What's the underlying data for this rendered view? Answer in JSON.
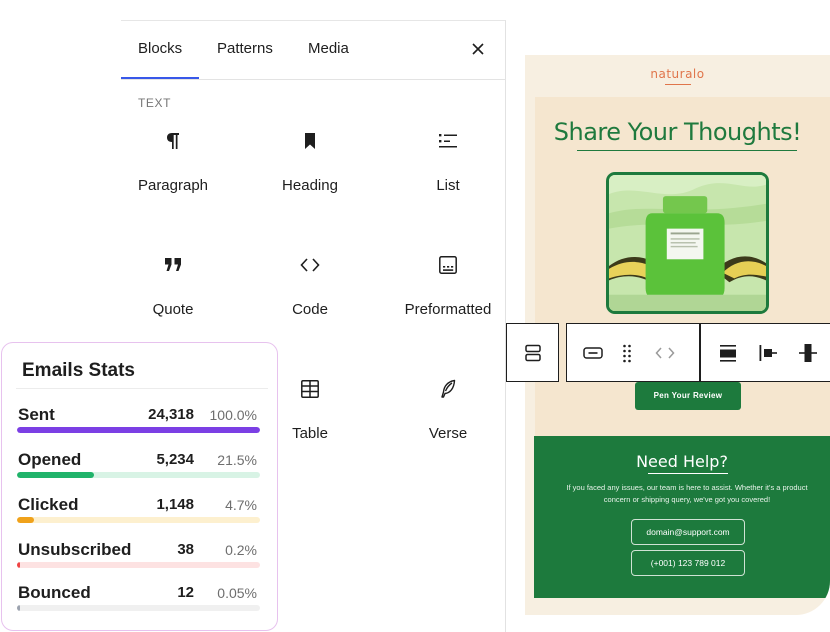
{
  "inserter": {
    "tabs": [
      {
        "label": "Blocks",
        "active": true
      },
      {
        "label": "Patterns",
        "active": false
      },
      {
        "label": "Media",
        "active": false
      }
    ],
    "close_icon": "close-icon",
    "section_label": "TEXT",
    "blocks": [
      {
        "label": "Paragraph",
        "icon": "paragraph-icon"
      },
      {
        "label": "Heading",
        "icon": "heading-bookmark-icon"
      },
      {
        "label": "List",
        "icon": "list-icon"
      },
      {
        "label": "Quote",
        "icon": "quote-icon"
      },
      {
        "label": "Code",
        "icon": "code-icon"
      },
      {
        "label": "Preformatted",
        "icon": "preformatted-icon"
      },
      {
        "label": "Table",
        "icon": "table-icon"
      },
      {
        "label": "Verse",
        "icon": "verse-feather-icon"
      }
    ]
  },
  "email": {
    "brand": "naturalo",
    "hero_title": "Share Your Thoughts!",
    "product_label": "GLOW RECIPE",
    "review_button": "Pen Your Review",
    "help_title": "Need Help?",
    "help_text": "If you faced any issues, our team is here to assist. Whether it's a product concern or shipping query, we've got you covered!",
    "contact_email": "domain@support.com",
    "contact_phone": "(+001) 123 789 012",
    "colors": {
      "brand_green": "#1d7a3d",
      "brand_orange": "#e0754b",
      "background": "#f7efe1"
    }
  },
  "toolbar": {
    "icons": [
      "group-block-icon",
      "button-block-icon",
      "drag-handle-icon",
      "move-arrows-icon",
      "align-top-icon",
      "align-left-icon",
      "align-center-icon"
    ]
  },
  "stats": {
    "title": "Emails Stats",
    "rows": [
      {
        "label": "Sent",
        "count": "24,318",
        "percent": "100.0%",
        "fill_fraction": 1.0,
        "color": "#7b3fe4",
        "track": "#ede4fb"
      },
      {
        "label": "Opened",
        "count": "5,234",
        "percent": "21.5%",
        "fill_fraction": 0.315,
        "color": "#20b36a",
        "track": "#d8f3e5"
      },
      {
        "label": "Clicked",
        "count": "1,148",
        "percent": "4.7%",
        "fill_fraction": 0.072,
        "color": "#f0a21b",
        "track": "#fdf0cf"
      },
      {
        "label": "Unsubscribed",
        "count": "38",
        "percent": "0.2%",
        "fill_fraction": 0.012,
        "color": "#ef4444",
        "track": "#fde2e2"
      },
      {
        "label": "Bounced",
        "count": "12",
        "percent": "0.05%",
        "fill_fraction": 0.006,
        "color": "#9ca3af",
        "track": "#f0f0f0"
      }
    ]
  }
}
